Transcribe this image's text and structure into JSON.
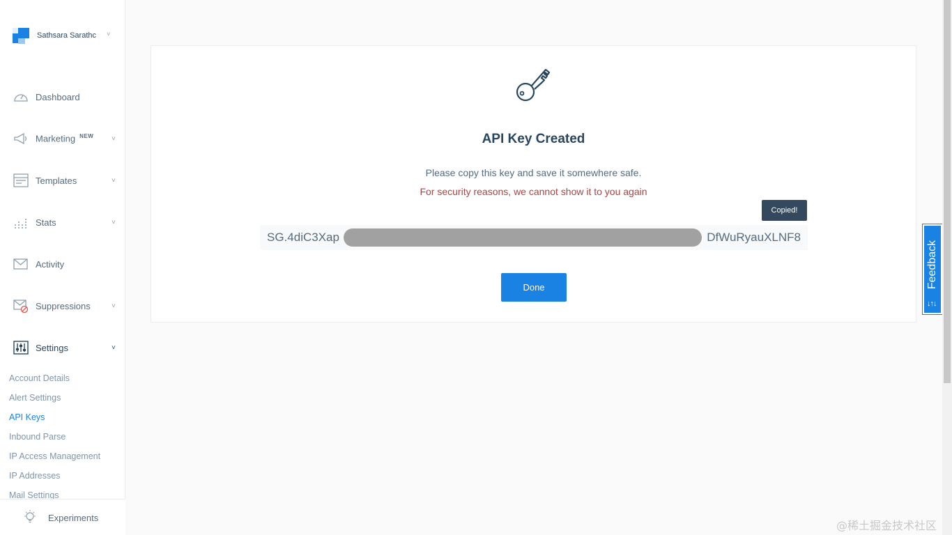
{
  "account": {
    "name": "Sathsara Sarathc",
    "caret": "˅"
  },
  "nav": {
    "dashboard": "Dashboard",
    "marketing": "Marketing",
    "marketing_badge": "NEW",
    "templates": "Templates",
    "stats": "Stats",
    "activity": "Activity",
    "suppressions": "Suppressions",
    "settings": "Settings",
    "caret": "˅"
  },
  "settings_sub": [
    "Account Details",
    "Alert Settings",
    "API Keys",
    "Inbound Parse",
    "IP Access Management",
    "IP Addresses",
    "Mail Settings"
  ],
  "experiments": "Experiments",
  "card": {
    "title": "API Key Created",
    "info": "Please copy this key and save it somewhere safe.",
    "warning": "For security reasons, we cannot show it to you again",
    "tooltip": "Copied!",
    "key_prefix": "SG.4diC3Xap",
    "key_suffix": "DfWuRyauXLNF8",
    "done": "Done"
  },
  "feedback": {
    "label": "Feedback",
    "icon": "↓↑↓"
  },
  "watermark": "@稀土掘金技术社区",
  "colors": {
    "accent": "#1a82e2",
    "warning": "#a94442",
    "text": "#294661"
  }
}
